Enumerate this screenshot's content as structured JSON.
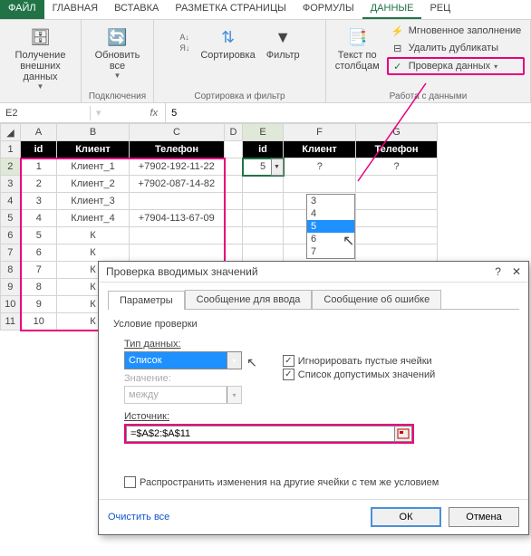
{
  "ribbon": {
    "tabs": [
      "ФАЙЛ",
      "ГЛАВНАЯ",
      "ВСТАВКА",
      "РАЗМЕТКА СТРАНИЦЫ",
      "ФОРМУЛЫ",
      "ДАННЫЕ",
      "РЕЦ"
    ],
    "active_index": 5,
    "groups": {
      "external": {
        "btn": "Получение\nвнешних данных",
        "label": ""
      },
      "connections": {
        "btn": "Обновить\nвсе",
        "label": "Подключения"
      },
      "sort_filter": {
        "sort_btn": "Сортировка",
        "filter_btn": "Фильтр",
        "label": "Сортировка и фильтр"
      },
      "data_tools": {
        "text_cols": "Текст по\nстолбцам",
        "flash_fill": "Мгновенное заполнение",
        "remove_dup": "Удалить дубликаты",
        "validation": "Проверка данных",
        "label": "Работа с данными"
      }
    }
  },
  "formula_bar": {
    "name_box": "E2",
    "value": "5"
  },
  "grid": {
    "col_headers": [
      "A",
      "B",
      "C",
      "D",
      "E",
      "F",
      "G"
    ],
    "row_headers": [
      1,
      2,
      3,
      4,
      5,
      6,
      7,
      8,
      9,
      10,
      11
    ],
    "left": {
      "headers": [
        "id",
        "Клиент",
        "Телефон"
      ],
      "rows": [
        [
          "1",
          "Клиент_1",
          "+7902-192-11-22"
        ],
        [
          "2",
          "Клиент_2",
          "+7902-087-14-82"
        ],
        [
          "3",
          "Клиент_3",
          ""
        ],
        [
          "4",
          "Клиент_4",
          "+7904-113-67-09"
        ],
        [
          "5",
          "К",
          ""
        ],
        [
          "6",
          "К",
          ""
        ],
        [
          "7",
          "К",
          ""
        ],
        [
          "8",
          "К",
          ""
        ],
        [
          "9",
          "К",
          ""
        ],
        [
          "10",
          "К",
          ""
        ]
      ]
    },
    "right": {
      "headers": [
        "id",
        "Клиент",
        "Телефон"
      ],
      "rows": [
        [
          "5",
          "?",
          "?"
        ]
      ]
    },
    "dropdown_items": [
      "3",
      "4",
      "5",
      "6",
      "7"
    ],
    "dropdown_sel_index": 2
  },
  "dialog": {
    "title": "Проверка вводимых значений",
    "tabs": [
      "Параметры",
      "Сообщение для ввода",
      "Сообщение об ошибке"
    ],
    "active_tab": 0,
    "section": "Условие проверки",
    "type_label": "Тип данных:",
    "type_value": "Список",
    "value_label": "Значение:",
    "value_value": "между",
    "source_label": "Источник:",
    "source_value": "=$A$2:$A$11",
    "chk_ignore": "Игнорировать пустые ячейки",
    "chk_list": "Список допустимых значений",
    "chk_spread": "Распространить изменения на другие ячейки с тем же условием",
    "clear_btn": "Очистить все",
    "ok_btn": "ОК",
    "cancel_btn": "Отмена"
  }
}
